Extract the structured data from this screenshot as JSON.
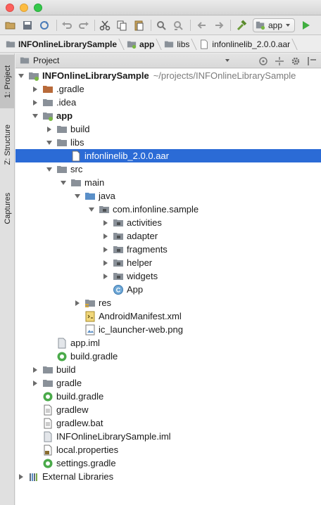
{
  "toolbar": {
    "run_config": "app",
    "icons": [
      "open-folder-icon",
      "save-icon",
      "sync-icon",
      "undo-icon",
      "redo-icon",
      "cut-icon",
      "copy-icon",
      "paste-icon",
      "find-icon",
      "replace-icon",
      "back-icon",
      "forward-icon",
      "build-hammer-icon",
      "run-icon"
    ]
  },
  "breadcrumb": [
    {
      "label": "INFOnlineLibrarySample",
      "icon": "project-folder-icon"
    },
    {
      "label": "app",
      "icon": "module-folder-icon"
    },
    {
      "label": "libs",
      "icon": "folder-icon"
    },
    {
      "label": "infonlinelib_2.0.0.aar",
      "icon": "file-icon"
    }
  ],
  "stripe": {
    "project": "1: Project",
    "structure": "Z: Structure",
    "captures": "Captures"
  },
  "panel": {
    "title": "Project"
  },
  "tree": [
    {
      "label": "INFOnlineLibrarySample",
      "path": "~/projects/INFOnlineLibrarySample",
      "icon": "module-folder-icon"
    },
    {
      "label": ".gradle",
      "icon": "folder-brown-icon"
    },
    {
      "label": ".idea",
      "icon": "folder-icon"
    },
    {
      "label": "app",
      "icon": "module-folder-icon"
    },
    {
      "label": "build",
      "icon": "folder-icon"
    },
    {
      "label": "libs",
      "icon": "folder-icon"
    },
    {
      "label": "infonlinelib_2.0.0.aar",
      "icon": "file-icon"
    },
    {
      "label": "src",
      "icon": "folder-icon"
    },
    {
      "label": "main",
      "icon": "folder-icon"
    },
    {
      "label": "java",
      "icon": "source-folder-icon"
    },
    {
      "label": "com.infonline.sample",
      "icon": "package-icon"
    },
    {
      "label": "activities",
      "icon": "package-icon"
    },
    {
      "label": "adapter",
      "icon": "package-icon"
    },
    {
      "label": "fragments",
      "icon": "package-icon"
    },
    {
      "label": "helper",
      "icon": "package-icon"
    },
    {
      "label": "widgets",
      "icon": "package-icon"
    },
    {
      "label": "App",
      "icon": "class-icon"
    },
    {
      "label": "res",
      "icon": "resource-folder-icon"
    },
    {
      "label": "AndroidManifest.xml",
      "icon": "manifest-icon"
    },
    {
      "label": "ic_launcher-web.png",
      "icon": "image-file-icon"
    },
    {
      "label": "app.iml",
      "icon": "iml-file-icon"
    },
    {
      "label": "build.gradle",
      "icon": "gradle-icon"
    },
    {
      "label": "build",
      "icon": "folder-icon"
    },
    {
      "label": "gradle",
      "icon": "folder-icon"
    },
    {
      "label": "build.gradle",
      "icon": "gradle-icon"
    },
    {
      "label": "gradlew",
      "icon": "text-file-icon"
    },
    {
      "label": "gradlew.bat",
      "icon": "text-file-icon"
    },
    {
      "label": "INFOnlineLibrarySample.iml",
      "icon": "iml-file-icon"
    },
    {
      "label": "local.properties",
      "icon": "properties-file-icon"
    },
    {
      "label": "settings.gradle",
      "icon": "gradle-icon"
    },
    {
      "label": "External Libraries",
      "icon": "libraries-icon"
    }
  ],
  "colors": {
    "selection": "#2b6bd6",
    "folder": "#8a9199",
    "source_folder": "#5a8fc8",
    "gradle": "#4aaa4a"
  }
}
